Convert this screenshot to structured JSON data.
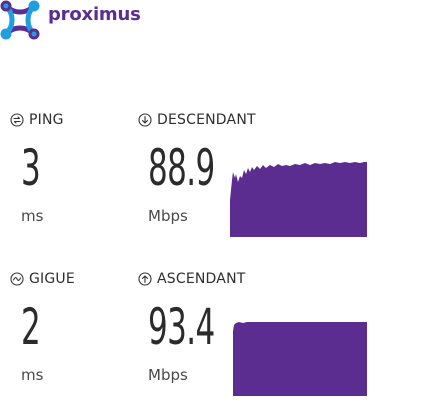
{
  "brand": {
    "name": "proximus",
    "text_color": "#5c2d91",
    "mark_color_blue": "#1e9fe0",
    "mark_color_purple": "#5c2d91"
  },
  "accent_color": "#5c2d91",
  "metrics": {
    "ping": {
      "label": "PING",
      "icon": "ping-icon",
      "value": "3",
      "unit": "ms"
    },
    "download": {
      "label": "DESCENDANT",
      "icon": "download-arrow-icon",
      "value": "88.9",
      "unit": "Mbps"
    },
    "jitter": {
      "label": "GIGUE",
      "icon": "jitter-wave-icon",
      "value": "2",
      "unit": "ms"
    },
    "upload": {
      "label": "ASCENDANT",
      "icon": "upload-arrow-icon",
      "value": "93.4",
      "unit": "Mbps"
    }
  }
}
